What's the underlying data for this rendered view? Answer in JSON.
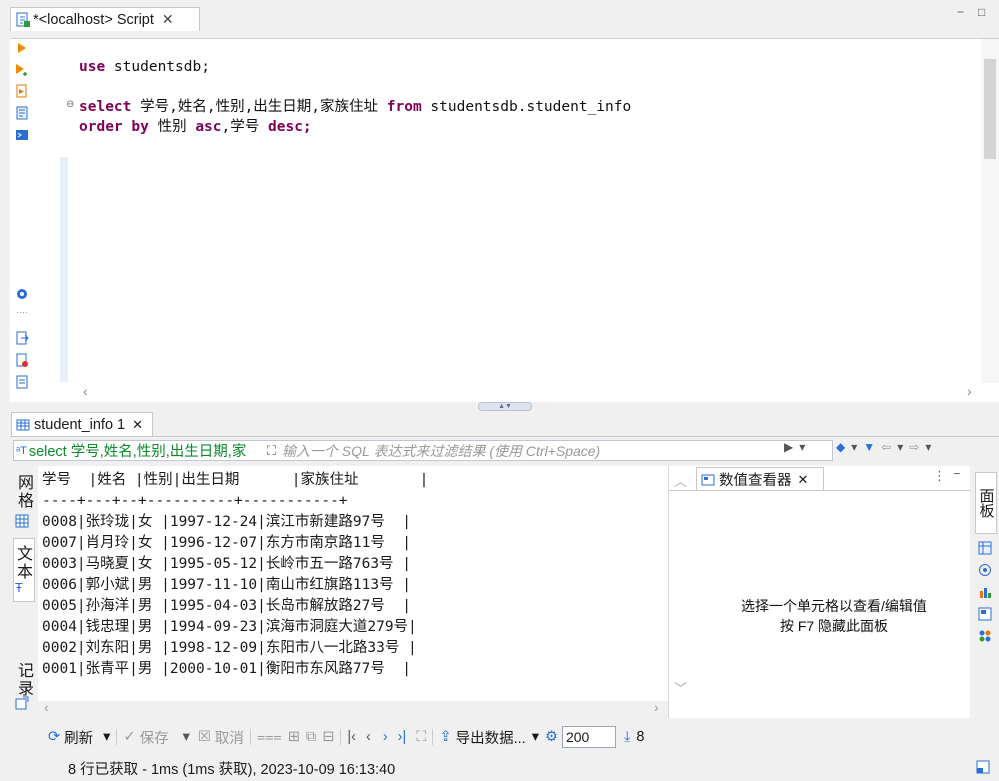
{
  "editor_tab": {
    "title": "*<localhost> Script",
    "close": "✕"
  },
  "window_controls": {
    "minimize": "−",
    "maximize": "□"
  },
  "script": {
    "line1": {
      "kw": "use",
      "rest": " studentsdb;"
    },
    "line2": {
      "kw1": "select",
      "cols": " 学号,姓名,性别,出生日期,家族住址 ",
      "kw2": "from",
      "table": " studentsdb.student_info"
    },
    "line3": {
      "kw1": "order",
      "mid": " ",
      "kw2": "by",
      "col1": " 性别 ",
      "kw3": "asc",
      "col2": ",学号 ",
      "kw4": "desc",
      "end": ";"
    }
  },
  "results_tab": {
    "title": "student_info 1",
    "close": "✕"
  },
  "filter": {
    "sql": "select 学号,姓名,性别,出生日期,家",
    "placeholder": "输入一个 SQL 表达式来过滤结果 (使用 Ctrl+Space)"
  },
  "side_tabs": {
    "grid": "网格",
    "text": "文本",
    "record": "记录"
  },
  "result_text": {
    "columns": [
      "学号",
      "姓名",
      "性别",
      "出生日期",
      "家族住址"
    ],
    "lines": [
      "学号  |姓名 |性别|出生日期      |家族住址       |",
      "----+---+--+----------+-----------+",
      "0008|张玲珑|女 |1997-12-24|滨江市新建路97号  |",
      "0007|肖月玲|女 |1996-12-07|东方市南京路11号  |",
      "0003|马晓夏|女 |1995-05-12|长岭市五一路763号 |",
      "0006|郭小斌|男 |1997-11-10|南山市红旗路113号 |",
      "0005|孙海洋|男 |1995-04-03|长岛市解放路27号  |",
      "0004|钱忠理|男 |1994-09-23|滨海市洞庭大道279号|",
      "0002|刘东阳|男 |1998-12-09|东阳市八一北路33号 |",
      "0001|张青平|男 |2000-10-01|衡阳市东风路77号  |"
    ],
    "rows": [
      [
        "0008",
        "张玲珑",
        "女",
        "1997-12-24",
        "滨江市新建路97号"
      ],
      [
        "0007",
        "肖月玲",
        "女",
        "1996-12-07",
        "东方市南京路11号"
      ],
      [
        "0003",
        "马晓夏",
        "女",
        "1995-05-12",
        "长岭市五一路763号"
      ],
      [
        "0006",
        "郭小斌",
        "男",
        "1997-11-10",
        "南山市红旗路113号"
      ],
      [
        "0005",
        "孙海洋",
        "男",
        "1995-04-03",
        "长岛市解放路27号"
      ],
      [
        "0004",
        "钱忠理",
        "男",
        "1994-09-23",
        "滨海市洞庭大道279号"
      ],
      [
        "0002",
        "刘东阳",
        "男",
        "1998-12-09",
        "东阳市八一北路33号"
      ],
      [
        "0001",
        "张青平",
        "男",
        "2000-10-01",
        "衡阳市东风路77号"
      ]
    ]
  },
  "value_viewer": {
    "title": "数值查看器",
    "close": "✕",
    "message_line1": "选择一个单元格以查看/编辑值",
    "message_line2": "按 F7 隐藏此面板"
  },
  "right_panel_tab": "面板",
  "toolbar": {
    "refresh": "刷新",
    "save": "保存",
    "cancel": "取消",
    "export": "导出数据...",
    "limit": "200",
    "row_count": "8"
  },
  "status": {
    "text": "8 行已获取 - 1ms (1ms 获取), 2023-10-09 16:13:40"
  },
  "colors": {
    "keyword": "#7f0055",
    "filter_sql": "#0b8a2a",
    "accent": "#2a6fd6"
  }
}
